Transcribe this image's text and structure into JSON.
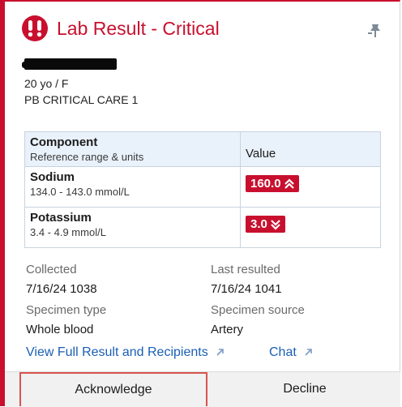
{
  "header": {
    "title": "Lab Result - Critical",
    "alert_icon": "critical-alert-icon",
    "pin_icon": "pin-icon",
    "accent_color": "#c8102e"
  },
  "patient": {
    "age_sex": "20 yo / F",
    "department": "PB CRITICAL CARE 1"
  },
  "table": {
    "header_component": "Component",
    "header_component_sub": "Reference range & units",
    "header_value": "Value",
    "rows": [
      {
        "name": "Sodium",
        "range": "134.0 - 143.0 mmol/L",
        "value": "160.0",
        "flag": "high",
        "flag_icon": "double-chevron-up-icon"
      },
      {
        "name": "Potassium",
        "range": "3.4 - 4.9 mmol/L",
        "value": "3.0",
        "flag": "low",
        "flag_icon": "double-chevron-down-icon"
      }
    ]
  },
  "details": {
    "collected_label": "Collected",
    "collected_value": "7/16/24 1038",
    "last_resulted_label": "Last resulted",
    "last_resulted_value": "7/16/24 1041",
    "specimen_type_label": "Specimen type",
    "specimen_type_value": "Whole blood",
    "specimen_source_label": "Specimen source",
    "specimen_source_value": "Artery"
  },
  "links": {
    "view_full": "View Full Result and Recipients",
    "chat": "Chat",
    "external_icon": "external-link-icon"
  },
  "actions": {
    "acknowledge": "Acknowledge",
    "decline": "Decline"
  }
}
